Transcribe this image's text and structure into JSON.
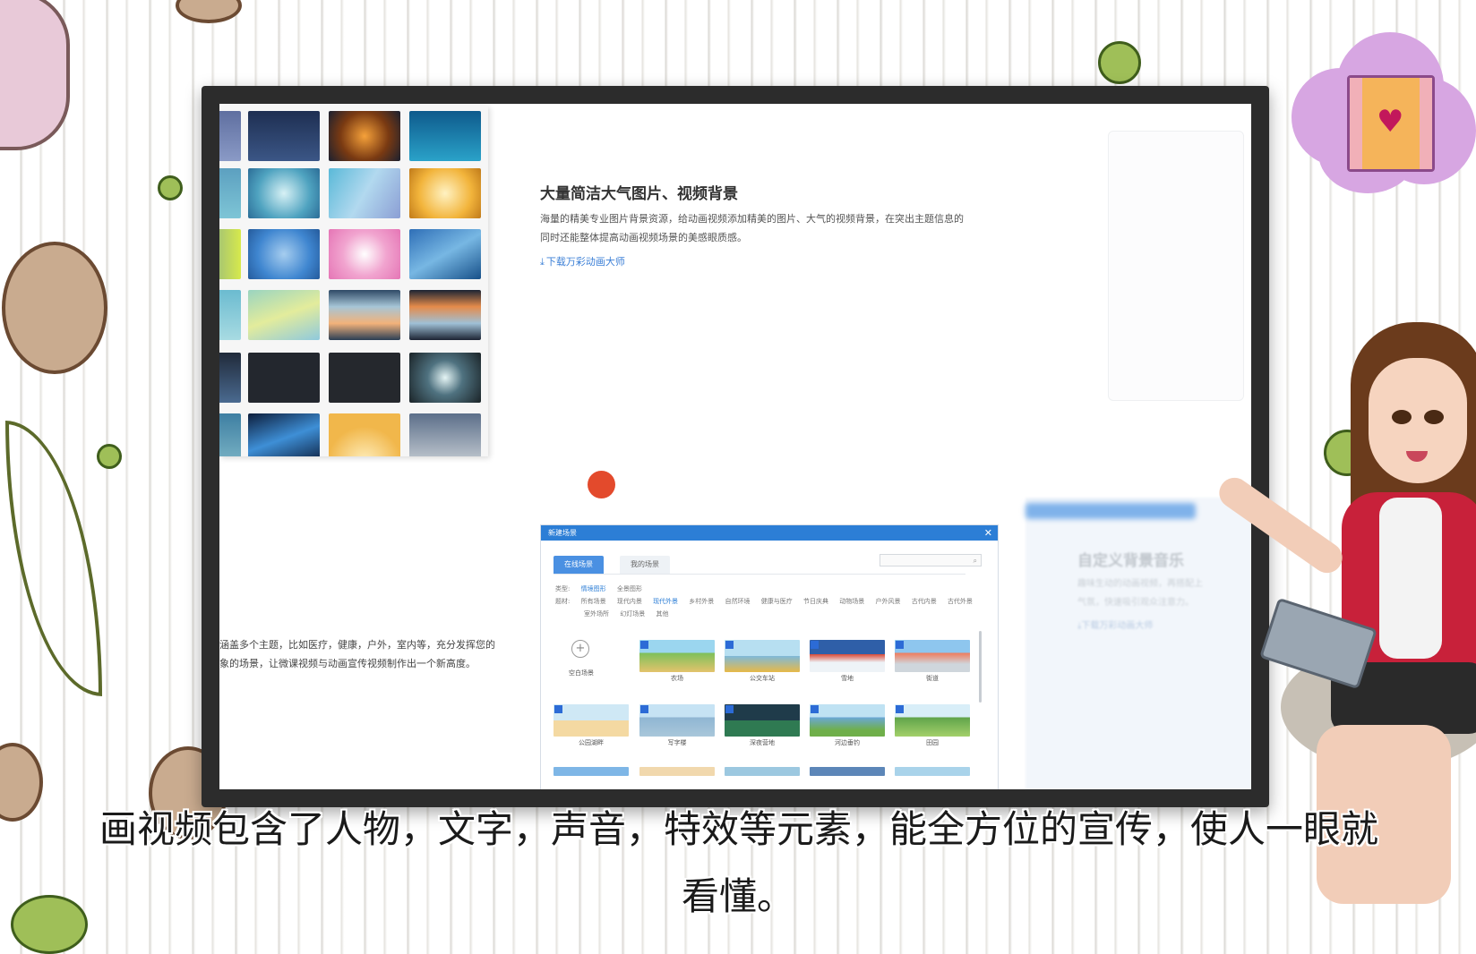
{
  "feature": {
    "title": "大量简洁大气图片、视频背景",
    "desc_line1": "海量的精美专业图片背景资源，给动画视频添加精美的图片、大气的视频背景，在突出主题信息的",
    "desc_line2": "同时还能整体提高动画视频场景的美感眼质感。",
    "link": "下载万彩动画大师"
  },
  "left_text": {
    "line1": "涵盖多个主题，比如医疗，健康，户外，室内等，充分发挥您的",
    "line2": "象的场景，让微课视频与动画宣传视频制作出一个新高度。"
  },
  "dialog": {
    "title": "新建场景",
    "close": "✕",
    "tabs": [
      "在线场景",
      "我的场景"
    ],
    "filter_rows": [
      [
        "类型:",
        "情境图形",
        "全景图形"
      ],
      [
        "题材:",
        "所有场景",
        "现代内景",
        "现代外景",
        "乡村外景",
        "自然环境",
        "健康与医疗",
        "节日庆典",
        "动物场景",
        "户外风景",
        "古代内景",
        "古代外景"
      ],
      [
        "",
        "室外场所",
        "幻灯场景",
        "其他"
      ]
    ],
    "add_label": "空白场景",
    "scenes": [
      "农场",
      "公交车站",
      "雪地",
      "街道",
      "公园湖畔",
      "写字楼",
      "深夜营地",
      "河边垂钓",
      "田园"
    ]
  },
  "right_panel": {
    "title": "自定义背景音乐",
    "desc_line1": "趣味生动的动画视频，再搭配上",
    "desc_line2": "气氛，快速吸引观众注意力。",
    "link": "下载万彩动画大师"
  },
  "subtitles": {
    "line1": "画视频包含了人物，文字，声音，特效等元素，能全方位的宣传，使人一眼就",
    "line2": "看懂。"
  },
  "icons": {
    "cloud_icon": "film-heart-icon",
    "download": "download-icon"
  }
}
